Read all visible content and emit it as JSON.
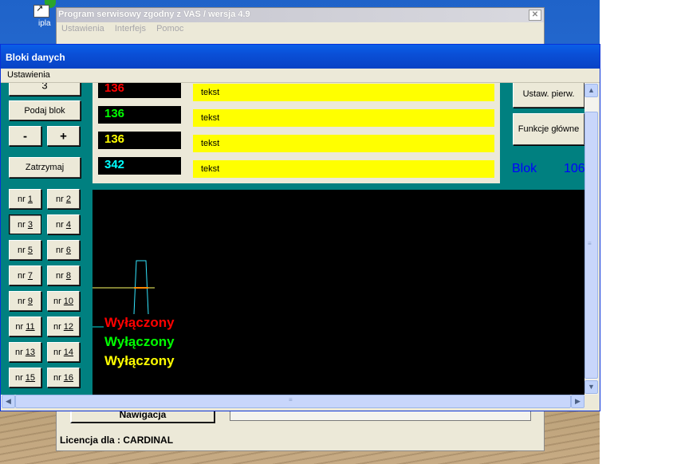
{
  "desktop": {
    "icon_label": "ipla"
  },
  "main_window": {
    "title": "Program serwisowy zgodny z VAS / wersja 4.9",
    "close_glyph": "✕",
    "menu": [
      "Ustawienia",
      "Interfejs",
      "Pomoc"
    ],
    "nav_button": "Nawigacja",
    "licence": "Licencja dla : CARDINAL"
  },
  "bloki_window": {
    "title": "Bloki danych",
    "menu": [
      "Ustawienia"
    ],
    "left_panel": {
      "block_number_value": "3",
      "get_block_button": "Podaj blok",
      "minus_button": "-",
      "plus_button": "+",
      "stop_button": "Zatrzymaj",
      "nr_buttons": [
        {
          "pre": "nr",
          "num": "1"
        },
        {
          "pre": "nr",
          "num": "2"
        },
        {
          "pre": "nr",
          "num": "3"
        },
        {
          "pre": "nr",
          "num": "4"
        },
        {
          "pre": "nr",
          "num": "5"
        },
        {
          "pre": "nr",
          "num": "6"
        },
        {
          "pre": "nr",
          "num": "7"
        },
        {
          "pre": "nr",
          "num": "8"
        },
        {
          "pre": "nr",
          "num": "9"
        },
        {
          "pre": "nr",
          "num": "10"
        },
        {
          "pre": "nr",
          "num": "11"
        },
        {
          "pre": "nr",
          "num": "12"
        },
        {
          "pre": "nr",
          "num": "13"
        },
        {
          "pre": "nr",
          "num": "14"
        },
        {
          "pre": "nr",
          "num": "15"
        },
        {
          "pre": "nr",
          "num": "16"
        }
      ],
      "selected_nr": "3"
    },
    "values": [
      {
        "value": "136",
        "color": "#ff0000",
        "text": "tekst"
      },
      {
        "value": "136",
        "color": "#00ff00",
        "text": "tekst"
      },
      {
        "value": "136",
        "color": "#ffff00",
        "text": "tekst"
      },
      {
        "value": "342",
        "color": "#00ffff",
        "text": "tekst"
      }
    ],
    "right_buttons": {
      "initial_settings": "Ustaw. pierw.",
      "main_functions": "Funkcje główne"
    },
    "blok_label": "Blok",
    "blok_number": "106",
    "status_lines": [
      {
        "text": "Wyłączony",
        "color": "#ff0000"
      },
      {
        "text": "Wyłączony",
        "color": "#00ff00"
      },
      {
        "text": "Wyłączony",
        "color": "#ffff00"
      }
    ],
    "scroll_icons": {
      "up": "▲",
      "down": "▼",
      "left": "◀",
      "right": "▶",
      "grip": "≡"
    }
  }
}
